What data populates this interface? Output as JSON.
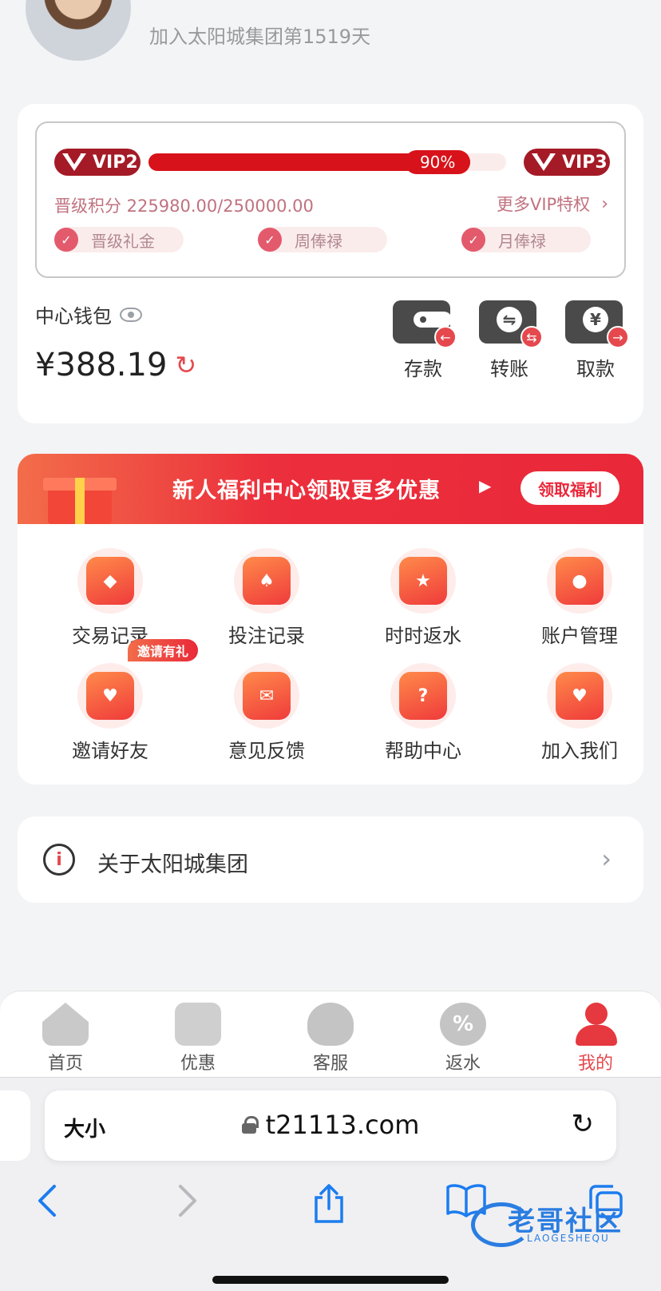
{
  "header": {
    "member_days_text": "加入太阳城集团第1519天"
  },
  "vip": {
    "current_level": "VIP2",
    "next_level": "VIP3",
    "progress_percent": 90,
    "progress_label": "90%",
    "points_text": "晋级积分 225980.00/250000.00",
    "more_link": "更多VIP特权",
    "perks": [
      "晋级礼金",
      "周俸禄",
      "月俸禄"
    ]
  },
  "wallet": {
    "label": "中心钱包",
    "balance": "¥388.19",
    "actions": [
      {
        "label": "存款",
        "icon": "wallet-deposit-icon"
      },
      {
        "label": "转账",
        "icon": "transfer-icon"
      },
      {
        "label": "取款",
        "icon": "withdraw-ticket-icon"
      }
    ]
  },
  "banner": {
    "text": "新人福利中心领取更多优惠",
    "button": "领取福利"
  },
  "menu": {
    "items": [
      {
        "label": "交易记录",
        "icon": "transaction-record-icon",
        "glyph": "◆"
      },
      {
        "label": "投注记录",
        "icon": "bet-record-icon",
        "glyph": "♠"
      },
      {
        "label": "时时返水",
        "icon": "rebate-icon",
        "glyph": "★"
      },
      {
        "label": "账户管理",
        "icon": "account-icon",
        "glyph": "●"
      },
      {
        "label": "邀请好友",
        "icon": "invite-icon",
        "glyph": "♥"
      },
      {
        "label": "意见反馈",
        "icon": "feedback-icon",
        "glyph": "✉"
      },
      {
        "label": "帮助中心",
        "icon": "help-icon",
        "glyph": "?"
      },
      {
        "label": "加入我们",
        "icon": "join-icon",
        "glyph": "♥"
      }
    ],
    "invite_tag": "邀请有礼"
  },
  "about": {
    "label": "关于太阳城集团"
  },
  "tabbar": {
    "items": [
      {
        "label": "首页",
        "icon": "home-icon"
      },
      {
        "label": "优惠",
        "icon": "gift-icon"
      },
      {
        "label": "客服",
        "icon": "customer-service-icon"
      },
      {
        "label": "返水",
        "icon": "rebate-percent-icon"
      },
      {
        "label": "我的",
        "icon": "profile-icon",
        "active": true
      }
    ]
  },
  "browser": {
    "text_size_button": "大小",
    "url": "t21113.com"
  },
  "watermark": {
    "text": "老哥社区",
    "sub": "LAOGESHEQU"
  },
  "colors": {
    "accent": "#e5484d",
    "vip_bar": "#d8121a",
    "banner": "#e9283a",
    "link": "#1c7cf0"
  }
}
